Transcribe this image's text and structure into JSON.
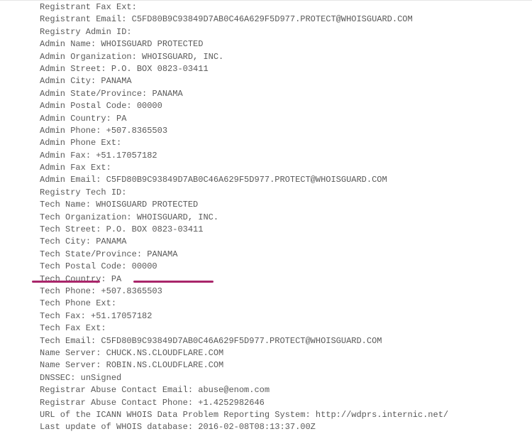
{
  "rows": [
    {
      "label": "Registrant Fax Ext",
      "value": ""
    },
    {
      "label": "Registrant Email",
      "value": "C5FD80B9C93849D7AB0C46A629F5D977.PROTECT@WHOISGUARD.COM"
    },
    {
      "label": "Registry Admin ID",
      "value": ""
    },
    {
      "label": "Admin Name",
      "value": "WHOISGUARD PROTECTED"
    },
    {
      "label": "Admin Organization",
      "value": "WHOISGUARD, INC."
    },
    {
      "label": "Admin Street",
      "value": "P.O. BOX 0823-03411"
    },
    {
      "label": "Admin City",
      "value": "PANAMA"
    },
    {
      "label": "Admin State/Province",
      "value": "PANAMA"
    },
    {
      "label": "Admin Postal Code",
      "value": "00000"
    },
    {
      "label": "Admin Country",
      "value": "PA"
    },
    {
      "label": "Admin Phone",
      "value": "+507.8365503"
    },
    {
      "label": "Admin Phone Ext",
      "value": ""
    },
    {
      "label": "Admin Fax",
      "value": "+51.17057182"
    },
    {
      "label": "Admin Fax Ext",
      "value": ""
    },
    {
      "label": "Admin Email",
      "value": "C5FD80B9C93849D7AB0C46A629F5D977.PROTECT@WHOISGUARD.COM"
    },
    {
      "label": "Registry Tech ID",
      "value": ""
    },
    {
      "label": "Tech Name",
      "value": "WHOISGUARD PROTECTED"
    },
    {
      "label": "Tech Organization",
      "value": "WHOISGUARD, INC."
    },
    {
      "label": "Tech Street",
      "value": "P.O. BOX 0823-03411"
    },
    {
      "label": "Tech City",
      "value": "PANAMA"
    },
    {
      "label": "Tech State/Province",
      "value": "PANAMA"
    },
    {
      "label": "Tech Postal Code",
      "value": "00000"
    },
    {
      "label": "Tech Country",
      "value": "PA"
    },
    {
      "label": "Tech Phone",
      "value": "+507.8365503"
    },
    {
      "label": "Tech Phone Ext",
      "value": ""
    },
    {
      "label": "Tech Fax",
      "value": "+51.17057182"
    },
    {
      "label": "Tech Fax Ext",
      "value": ""
    },
    {
      "label": "Tech Email",
      "value": "C5FD80B9C93849D7AB0C46A629F5D977.PROTECT@WHOISGUARD.COM"
    },
    {
      "label": "Name Server",
      "value": "CHUCK.NS.CLOUDFLARE.COM"
    },
    {
      "label": "Name Server",
      "value": "ROBIN.NS.CLOUDFLARE.COM"
    },
    {
      "label": "DNSSEC",
      "value": "unSigned"
    },
    {
      "label": "Registrar Abuse Contact Email",
      "value": "abuse@enom.com"
    },
    {
      "label": "Registrar Abuse Contact Phone",
      "value": "+1.4252982646"
    },
    {
      "label": "URL of the ICANN WHOIS Data Problem Reporting System",
      "value": "http://wdprs.internic.net/"
    },
    {
      "label": "Last update of WHOIS database",
      "value": "2016-02-08T08:13:37.00Z"
    }
  ],
  "separator_with_value": ": ",
  "separator_no_value": ":"
}
